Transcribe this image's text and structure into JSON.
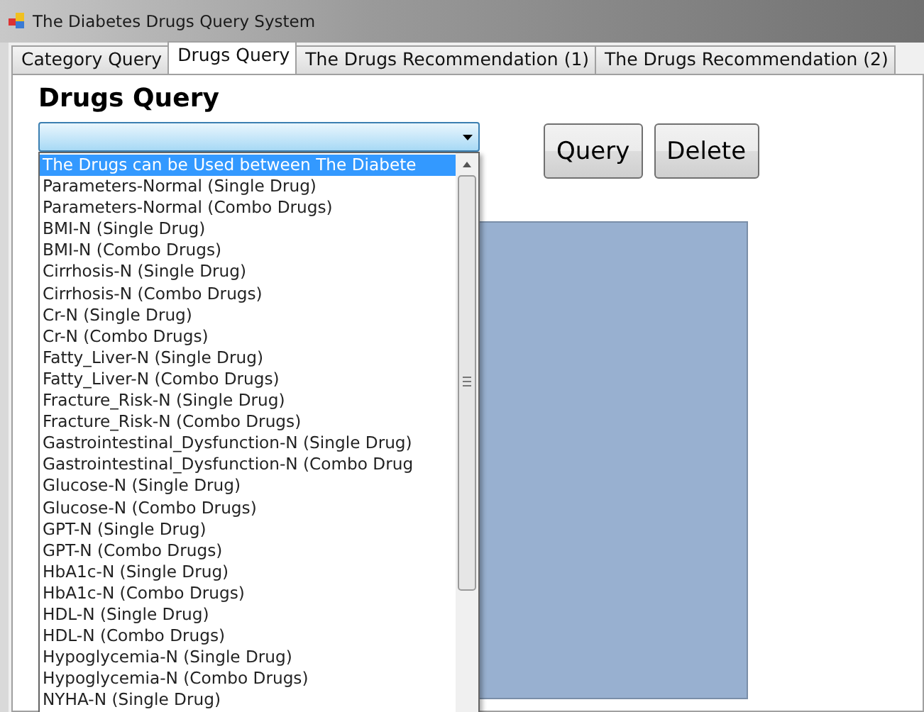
{
  "window": {
    "title": "The Diabetes Drugs Query System"
  },
  "tabs": [
    {
      "label": "Category Query",
      "selected": false
    },
    {
      "label": "Drugs Query",
      "selected": true
    },
    {
      "label": "The Drugs Recommendation (1)",
      "selected": false
    },
    {
      "label": "The Drugs Recommendation (2)",
      "selected": false
    }
  ],
  "heading": "Drugs Query",
  "dropdown": {
    "expanded": true,
    "options": [
      {
        "label": "The Drugs can be Used between The Diabete",
        "selected": true
      },
      {
        "label": "Parameters-Normal (Single Drug)",
        "selected": false
      },
      {
        "label": "Parameters-Normal (Combo Drugs)",
        "selected": false
      },
      {
        "label": "BMI-N (Single Drug)",
        "selected": false
      },
      {
        "label": "BMI-N (Combo Drugs)",
        "selected": false
      },
      {
        "label": "Cirrhosis-N (Single Drug)",
        "selected": false
      },
      {
        "label": "Cirrhosis-N (Combo Drugs)",
        "selected": false
      },
      {
        "label": "Cr-N (Single Drug)",
        "selected": false
      },
      {
        "label": "Cr-N (Combo Drugs)",
        "selected": false
      },
      {
        "label": "Fatty_Liver-N (Single Drug)",
        "selected": false
      },
      {
        "label": "Fatty_Liver-N (Combo Drugs)",
        "selected": false
      },
      {
        "label": "Fracture_Risk-N (Single Drug)",
        "selected": false
      },
      {
        "label": "Fracture_Risk-N (Combo Drugs)",
        "selected": false
      },
      {
        "label": "Gastrointestinal_Dysfunction-N (Single Drug)",
        "selected": false
      },
      {
        "label": "Gastrointestinal_Dysfunction-N (Combo Drug",
        "selected": false
      },
      {
        "label": "Glucose-N (Single Drug)",
        "selected": false
      },
      {
        "label": "Glucose-N (Combo Drugs)",
        "selected": false
      },
      {
        "label": "GPT-N (Single Drug)",
        "selected": false
      },
      {
        "label": "GPT-N (Combo Drugs)",
        "selected": false
      },
      {
        "label": "HbA1c-N (Single Drug)",
        "selected": false
      },
      {
        "label": "HbA1c-N (Combo Drugs)",
        "selected": false
      },
      {
        "label": "HDL-N (Single Drug)",
        "selected": false
      },
      {
        "label": "HDL-N (Combo Drugs)",
        "selected": false
      },
      {
        "label": "Hypoglycemia-N (Single Drug)",
        "selected": false
      },
      {
        "label": "Hypoglycemia-N (Combo Drugs)",
        "selected": false
      },
      {
        "label": "NYHA-N (Single Drug)",
        "selected": false
      }
    ]
  },
  "buttons": [
    {
      "label": "Query"
    },
    {
      "label": "Delete"
    }
  ]
}
